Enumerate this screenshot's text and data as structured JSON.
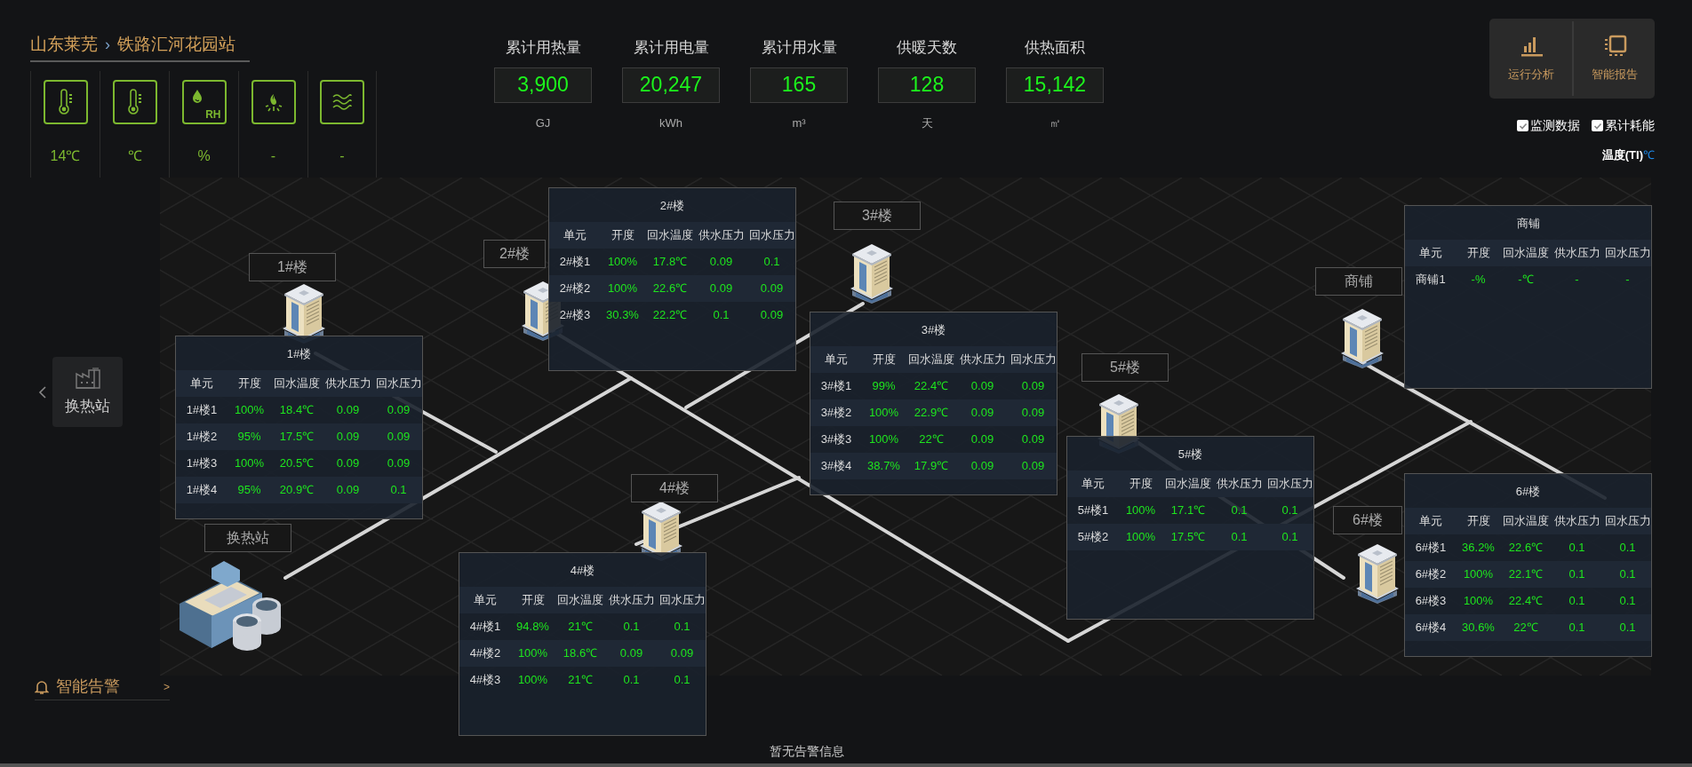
{
  "breadcrumb": {
    "region": "山东莱芜",
    "separator": "›",
    "station": "铁路汇河花园站"
  },
  "sensors": [
    {
      "kind": "thermometer",
      "value": "14℃"
    },
    {
      "kind": "thermometer",
      "value": "℃"
    },
    {
      "kind": "humidity",
      "icon_text": "RH",
      "value": "%"
    },
    {
      "kind": "fire",
      "value": "-"
    },
    {
      "kind": "waves",
      "value": "-"
    }
  ],
  "stats": [
    {
      "label": "累计用热量",
      "value": "3,900",
      "unit": "GJ"
    },
    {
      "label": "累计用电量",
      "value": "20,247",
      "unit": "kWh"
    },
    {
      "label": "累计用水量",
      "value": "165",
      "unit": "m³"
    },
    {
      "label": "供暖天数",
      "value": "128",
      "unit": "天"
    },
    {
      "label": "供热面积",
      "value": "15,142",
      "unit": "㎡"
    }
  ],
  "actions": [
    {
      "kind": "chart",
      "label": "运行分析"
    },
    {
      "kind": "report",
      "label": "智能报告"
    }
  ],
  "toggles": [
    {
      "label": "监测数据",
      "checked": true
    },
    {
      "label": "累计耗能",
      "checked": true
    }
  ],
  "legend": {
    "label": "温度(TI)",
    "unit": "℃"
  },
  "side_nav": {
    "item": "换热站"
  },
  "map": {
    "station_label": "换热站",
    "buildings": [
      {
        "label": "1#楼",
        "panel": {
          "title": "1#楼",
          "columns": [
            "单元",
            "开度",
            "回水温度",
            "供水压力",
            "回水压力"
          ],
          "rows": [
            [
              "1#楼1",
              "100%",
              "18.4℃",
              "0.09",
              "0.09"
            ],
            [
              "1#楼2",
              "95%",
              "17.5℃",
              "0.09",
              "0.09"
            ],
            [
              "1#楼3",
              "100%",
              "20.5℃",
              "0.09",
              "0.09"
            ],
            [
              "1#楼4",
              "95%",
              "20.9℃",
              "0.09",
              "0.1"
            ]
          ]
        }
      },
      {
        "label": "2#楼",
        "panel": {
          "title": "2#楼",
          "columns": [
            "单元",
            "开度",
            "回水温度",
            "供水压力",
            "回水压力"
          ],
          "rows": [
            [
              "2#楼1",
              "100%",
              "17.8℃",
              "0.09",
              "0.1"
            ],
            [
              "2#楼2",
              "100%",
              "22.6℃",
              "0.09",
              "0.09"
            ],
            [
              "2#楼3",
              "30.3%",
              "22.2℃",
              "0.1",
              "0.09"
            ]
          ]
        }
      },
      {
        "label": "3#楼",
        "panel": {
          "title": "3#楼",
          "columns": [
            "单元",
            "开度",
            "回水温度",
            "供水压力",
            "回水压力"
          ],
          "rows": [
            [
              "3#楼1",
              "99%",
              "22.4℃",
              "0.09",
              "0.09"
            ],
            [
              "3#楼2",
              "100%",
              "22.9℃",
              "0.09",
              "0.09"
            ],
            [
              "3#楼3",
              "100%",
              "22℃",
              "0.09",
              "0.09"
            ],
            [
              "3#楼4",
              "38.7%",
              "17.9℃",
              "0.09",
              "0.09"
            ]
          ]
        }
      },
      {
        "label": "4#楼",
        "panel": {
          "title": "4#楼",
          "columns": [
            "单元",
            "开度",
            "回水温度",
            "供水压力",
            "回水压力"
          ],
          "rows": [
            [
              "4#楼1",
              "94.8%",
              "21℃",
              "0.1",
              "0.1"
            ],
            [
              "4#楼2",
              "100%",
              "18.6℃",
              "0.09",
              "0.09"
            ],
            [
              "4#楼3",
              "100%",
              "21℃",
              "0.1",
              "0.1"
            ]
          ]
        }
      },
      {
        "label": "5#楼",
        "panel": {
          "title": "5#楼",
          "columns": [
            "单元",
            "开度",
            "回水温度",
            "供水压力",
            "回水压力"
          ],
          "rows": [
            [
              "5#楼1",
              "100%",
              "17.1℃",
              "0.1",
              "0.1"
            ],
            [
              "5#楼2",
              "100%",
              "17.5℃",
              "0.1",
              "0.1"
            ]
          ]
        }
      },
      {
        "label": "商铺",
        "panel": {
          "title": "商铺",
          "columns": [
            "单元",
            "开度",
            "回水温度",
            "供水压力",
            "回水压力"
          ],
          "rows": [
            [
              "商铺1",
              "-%",
              "-℃",
              "-",
              "-"
            ]
          ]
        }
      },
      {
        "label": "6#楼",
        "panel": {
          "title": "6#楼",
          "columns": [
            "单元",
            "开度",
            "回水温度",
            "供水压力",
            "回水压力"
          ],
          "rows": [
            [
              "6#楼1",
              "36.2%",
              "22.6℃",
              "0.1",
              "0.1"
            ],
            [
              "6#楼2",
              "100%",
              "22.1℃",
              "0.1",
              "0.1"
            ],
            [
              "6#楼3",
              "100%",
              "22.4℃",
              "0.1",
              "0.1"
            ],
            [
              "6#楼4",
              "30.6%",
              "22℃",
              "0.1",
              "0.1"
            ]
          ]
        }
      }
    ]
  },
  "alarm": {
    "label": "智能告警",
    "arrow": ">",
    "message": "暂无告警信息"
  }
}
